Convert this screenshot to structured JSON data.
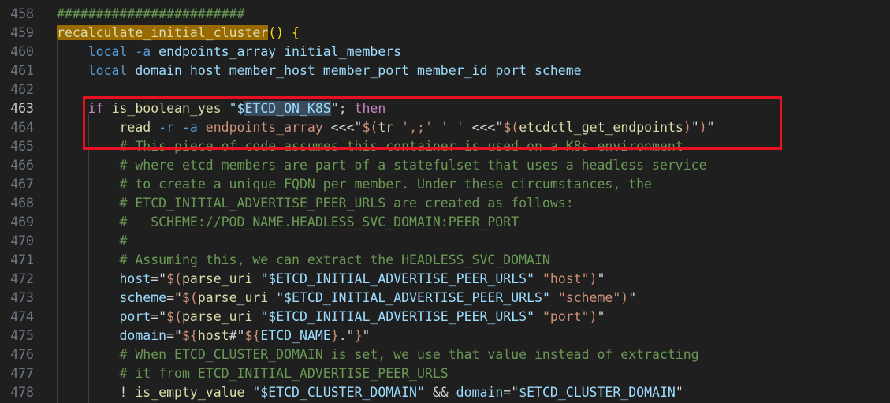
{
  "editor": {
    "current_line": 463,
    "colors": {
      "background": "#1f1f1f",
      "highlight_box": "#e81123",
      "function_highlight": "#996a00",
      "selection": "#3a4b5c"
    },
    "lines": [
      {
        "n": "458",
        "tokens": [
          [
            "########################",
            "com"
          ]
        ]
      },
      {
        "n": "459",
        "tokens": [
          [
            "recalculate_initial_cluster",
            "fnhl"
          ],
          [
            "() {",
            "brace"
          ]
        ]
      },
      {
        "n": "460",
        "tokens": [
          [
            "    ",
            ""
          ],
          [
            "local",
            "opt"
          ],
          [
            " ",
            ""
          ],
          [
            "-a",
            "opt"
          ],
          [
            " ",
            ""
          ],
          [
            "endpoints_array initial_members",
            "var"
          ]
        ]
      },
      {
        "n": "461",
        "tokens": [
          [
            "    ",
            ""
          ],
          [
            "local",
            "opt"
          ],
          [
            " ",
            ""
          ],
          [
            "domain host member_host member_port member_id port scheme",
            "var"
          ]
        ]
      },
      {
        "n": "462",
        "tokens": []
      },
      {
        "n": "463",
        "tokens": [
          [
            "    ",
            ""
          ],
          [
            "if",
            "kw"
          ],
          [
            " ",
            ""
          ],
          [
            "is_boolean_yes",
            "fn"
          ],
          [
            " ",
            ""
          ],
          [
            "\"$",
            "var"
          ],
          [
            "ETCD_ON_K8S",
            "sel"
          ],
          [
            "\"",
            "var"
          ],
          [
            "; ",
            ""
          ],
          [
            "then",
            "kw"
          ]
        ]
      },
      {
        "n": "464",
        "tokens": [
          [
            "        ",
            ""
          ],
          [
            "read",
            "fn"
          ],
          [
            " ",
            ""
          ],
          [
            "-r",
            "opt"
          ],
          [
            " ",
            ""
          ],
          [
            "-a",
            "opt"
          ],
          [
            " ",
            ""
          ],
          [
            "endpoints_array",
            "str"
          ],
          [
            " <<<\"",
            ""
          ],
          [
            "$(",
            "str"
          ],
          [
            "tr",
            "fn"
          ],
          [
            " ",
            ""
          ],
          [
            "',;'",
            "str"
          ],
          [
            " ",
            ""
          ],
          [
            "' '",
            "str"
          ],
          [
            " <<<\"",
            ""
          ],
          [
            "$(",
            "str"
          ],
          [
            "etcdctl_get_endpoints",
            "fn"
          ],
          [
            ")",
            "str"
          ],
          [
            "\"",
            ""
          ],
          [
            ")",
            "str"
          ],
          [
            "\"",
            ""
          ]
        ]
      },
      {
        "n": "465",
        "tokens": [
          [
            "        ",
            ""
          ],
          [
            "# This piece of code assumes this container is used on a K8s environment",
            "com"
          ]
        ]
      },
      {
        "n": "466",
        "tokens": [
          [
            "        ",
            ""
          ],
          [
            "# where etcd members are part of a statefulset that uses a headless service",
            "com"
          ]
        ]
      },
      {
        "n": "467",
        "tokens": [
          [
            "        ",
            ""
          ],
          [
            "# to create a unique FQDN per member. Under these circumstances, the",
            "com"
          ]
        ]
      },
      {
        "n": "468",
        "tokens": [
          [
            "        ",
            ""
          ],
          [
            "# ETCD_INITIAL_ADVERTISE_PEER_URLS are created as follows:",
            "com"
          ]
        ]
      },
      {
        "n": "469",
        "tokens": [
          [
            "        ",
            ""
          ],
          [
            "#   SCHEME://POD_NAME.HEADLESS_SVC_DOMAIN:PEER_PORT",
            "com"
          ]
        ]
      },
      {
        "n": "470",
        "tokens": [
          [
            "        ",
            ""
          ],
          [
            "#",
            "com"
          ]
        ]
      },
      {
        "n": "471",
        "tokens": [
          [
            "        ",
            ""
          ],
          [
            "# Assuming this, we can extract the HEADLESS_SVC_DOMAIN",
            "com"
          ]
        ]
      },
      {
        "n": "472",
        "tokens": [
          [
            "        ",
            ""
          ],
          [
            "host",
            "var"
          ],
          [
            "=\"",
            ""
          ],
          [
            "$(",
            "str"
          ],
          [
            "parse_uri",
            "fn"
          ],
          [
            " ",
            ""
          ],
          [
            "\"$ETCD_INITIAL_ADVERTISE_PEER_URLS\"",
            "var"
          ],
          [
            " ",
            ""
          ],
          [
            "\"host\"",
            "str"
          ],
          [
            ")",
            "str"
          ],
          [
            "\"",
            ""
          ]
        ]
      },
      {
        "n": "473",
        "tokens": [
          [
            "        ",
            ""
          ],
          [
            "scheme",
            "var"
          ],
          [
            "=\"",
            ""
          ],
          [
            "$(",
            "str"
          ],
          [
            "parse_uri",
            "fn"
          ],
          [
            " ",
            ""
          ],
          [
            "\"$ETCD_INITIAL_ADVERTISE_PEER_URLS\"",
            "var"
          ],
          [
            " ",
            ""
          ],
          [
            "\"scheme\"",
            "str"
          ],
          [
            ")",
            "str"
          ],
          [
            "\"",
            ""
          ]
        ]
      },
      {
        "n": "474",
        "tokens": [
          [
            "        ",
            ""
          ],
          [
            "port",
            "var"
          ],
          [
            "=\"",
            ""
          ],
          [
            "$(",
            "str"
          ],
          [
            "parse_uri",
            "fn"
          ],
          [
            " ",
            ""
          ],
          [
            "\"$ETCD_INITIAL_ADVERTISE_PEER_URLS\"",
            "var"
          ],
          [
            " ",
            ""
          ],
          [
            "\"port\"",
            "str"
          ],
          [
            ")",
            "str"
          ],
          [
            "\"",
            ""
          ]
        ]
      },
      {
        "n": "475",
        "tokens": [
          [
            "        ",
            ""
          ],
          [
            "domain",
            "var"
          ],
          [
            "=\"",
            ""
          ],
          [
            "${",
            "str"
          ],
          [
            "host",
            "fn"
          ],
          [
            "#\"",
            ""
          ],
          [
            "${",
            "str"
          ],
          [
            "ETCD_NAME",
            "var"
          ],
          [
            "}",
            "str"
          ],
          [
            ".\"",
            ""
          ],
          [
            "}",
            "str"
          ],
          [
            "\"",
            ""
          ]
        ]
      },
      {
        "n": "476",
        "tokens": [
          [
            "        ",
            ""
          ],
          [
            "# When ETCD_CLUSTER_DOMAIN is set, we use that value instead of extracting",
            "com"
          ]
        ]
      },
      {
        "n": "477",
        "tokens": [
          [
            "        ",
            ""
          ],
          [
            "# it from ETCD_INITIAL_ADVERTISE_PEER_URLS",
            "com"
          ]
        ]
      },
      {
        "n": "478",
        "tokens": [
          [
            "        ",
            ""
          ],
          [
            "! ",
            ""
          ],
          [
            "is_empty_value",
            "fn"
          ],
          [
            " ",
            ""
          ],
          [
            "\"$ETCD_CLUSTER_DOMAIN\"",
            "var"
          ],
          [
            " && ",
            ""
          ],
          [
            "domain",
            "var"
          ],
          [
            "=\"",
            ""
          ],
          [
            "$ETCD_CLUSTER_DOMAIN",
            "var"
          ],
          [
            "\"",
            ""
          ]
        ]
      }
    ]
  }
}
